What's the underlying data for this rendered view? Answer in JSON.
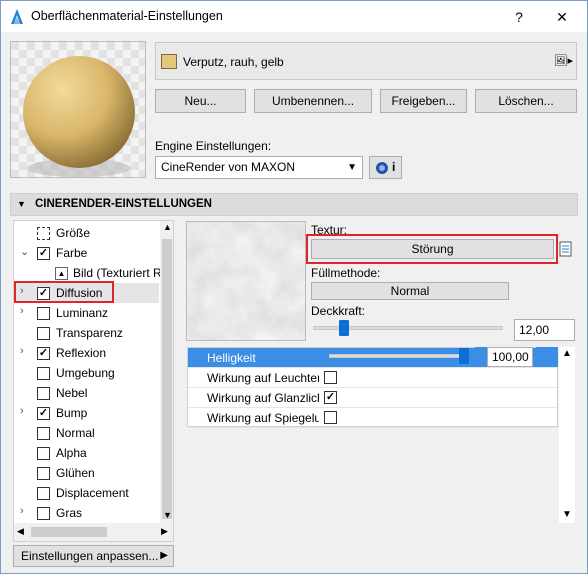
{
  "window": {
    "title": "Oberflächenmaterial-Einstellungen",
    "help_label": "?",
    "close_label": "✕"
  },
  "material": {
    "name": "Verputz, rauh, gelb",
    "swatch_color": "#e3c77a"
  },
  "buttons": {
    "new": "Neu...",
    "rename": "Umbenennen...",
    "share": "Freigeben...",
    "delete": "Löschen..."
  },
  "engine": {
    "label": "Engine Einstellungen:",
    "value": "CineRender von MAXON",
    "info_label": "i"
  },
  "section": {
    "title": "CINERENDER-EINSTELLUNGEN"
  },
  "channels": [
    {
      "label": "Größe",
      "expand": "",
      "check": "none",
      "icon": "resize-icon"
    },
    {
      "label": "Farbe",
      "expand": "v",
      "check": "checked"
    },
    {
      "label": "Bild (Texturiert Rendern)",
      "expand": "",
      "check": "image",
      "indent": true
    },
    {
      "label": "Diffusion",
      "expand": ">",
      "check": "checked",
      "selected": true
    },
    {
      "label": "Luminanz",
      "expand": ">",
      "check": "unchecked"
    },
    {
      "label": "Transparenz",
      "expand": "",
      "check": "unchecked"
    },
    {
      "label": "Reflexion",
      "expand": ">",
      "check": "checked"
    },
    {
      "label": "Umgebung",
      "expand": "",
      "check": "unchecked"
    },
    {
      "label": "Nebel",
      "expand": "",
      "check": "unchecked"
    },
    {
      "label": "Bump",
      "expand": ">",
      "check": "checked"
    },
    {
      "label": "Normal",
      "expand": "",
      "check": "unchecked"
    },
    {
      "label": "Alpha",
      "expand": "",
      "check": "unchecked"
    },
    {
      "label": "Glühen",
      "expand": "",
      "check": "unchecked"
    },
    {
      "label": "Displacement",
      "expand": "",
      "check": "unchecked"
    },
    {
      "label": "Gras",
      "expand": ">",
      "check": "unchecked"
    }
  ],
  "customize_button": "Einstellungen anpassen...",
  "texture": {
    "label": "Textur:",
    "value": "Störung",
    "fill_label": "Füllmethode:",
    "fill_value": "Normal",
    "opacity_label": "Deckkraft:",
    "opacity_value": "12,00"
  },
  "properties": {
    "brightness_label": "Helligkeit",
    "brightness_value": "100,00",
    "rows": [
      {
        "label": "Wirkung auf Leuchten",
        "checked": false
      },
      {
        "label": "Wirkung auf Glanzlicht",
        "checked": true
      },
      {
        "label": "Wirkung auf Spiegelung",
        "checked": false
      }
    ]
  },
  "colors": {
    "accent": "#0a6fd9",
    "highlight_box": "#e0242c",
    "selection": "#3a8ee6"
  }
}
